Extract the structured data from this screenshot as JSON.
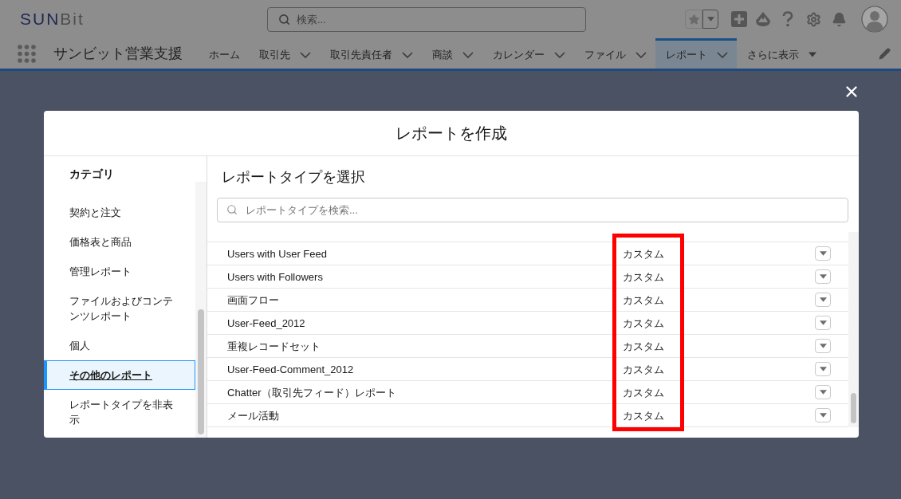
{
  "header": {
    "logo": [
      "SUN",
      "Bit"
    ],
    "search": {
      "placeholder": "検索..."
    }
  },
  "nav": {
    "app_name": "サンビット営業支援",
    "tabs": [
      {
        "label": "ホーム",
        "kind": "plain",
        "selected": false
      },
      {
        "label": "取引先",
        "kind": "menu",
        "selected": false
      },
      {
        "label": "取引先責任者",
        "kind": "menu",
        "selected": false
      },
      {
        "label": "商談",
        "kind": "menu",
        "selected": false
      },
      {
        "label": "カレンダー",
        "kind": "menu",
        "selected": false
      },
      {
        "label": "ファイル",
        "kind": "menu",
        "selected": false
      },
      {
        "label": "レポート",
        "kind": "menu",
        "selected": true
      },
      {
        "label": "さらに表示",
        "kind": "more",
        "selected": false
      }
    ]
  },
  "modal": {
    "title": "レポートを作成",
    "sidebar": {
      "heading": "カテゴリ",
      "items": [
        {
          "label": "契約と注文",
          "selected": false
        },
        {
          "label": "価格表と商品",
          "selected": false
        },
        {
          "label": "管理レポート",
          "selected": false
        },
        {
          "label": "ファイルおよびコンテンツレポート",
          "selected": false
        },
        {
          "label": "個人",
          "selected": false
        },
        {
          "label": "その他のレポート",
          "selected": true
        },
        {
          "label": "レポートタイプを非表示",
          "selected": false
        }
      ]
    },
    "main": {
      "heading": "レポートタイプを選択",
      "search": {
        "placeholder": "レポートタイプを検索..."
      },
      "type_column_highlighted": true,
      "rows": [
        {
          "name": "Users with User Feed",
          "type": "カスタム"
        },
        {
          "name": "Users with Followers",
          "type": "カスタム"
        },
        {
          "name": "画面フロー",
          "type": "カスタム"
        },
        {
          "name": "User-Feed_2012",
          "type": "カスタム"
        },
        {
          "name": "重複レコードセット",
          "type": "カスタム"
        },
        {
          "name": "User-Feed-Comment_2012",
          "type": "カスタム"
        },
        {
          "name": "Chatter（取引先フィード）レポート",
          "type": "カスタム"
        },
        {
          "name": "メール活動",
          "type": "カスタム"
        }
      ]
    }
  }
}
